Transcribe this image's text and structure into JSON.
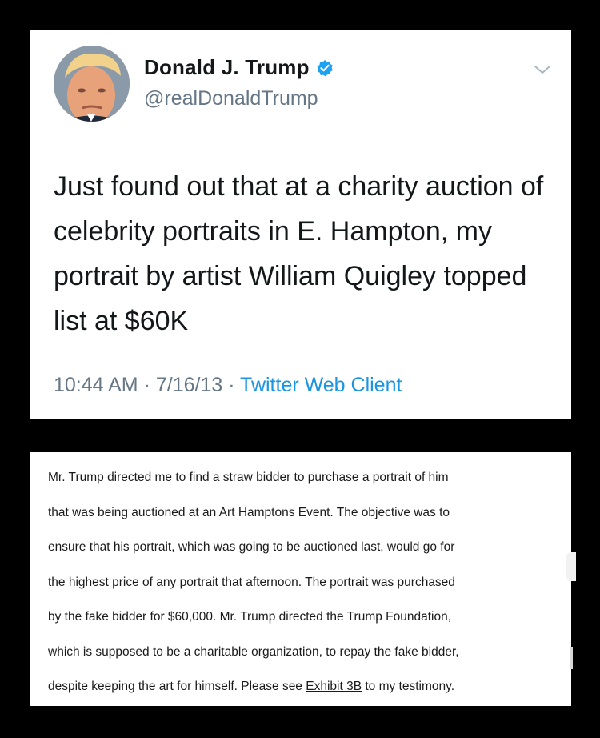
{
  "tweet": {
    "display_name": "Donald J. Trump",
    "handle": "@realDonaldTrump",
    "text": "Just found out that at a charity auction of celebrity portraits in E. Hampton, my portrait by artist William Quigley topped  list at $60K",
    "time": "10:44 AM",
    "separator": " · ",
    "date": "7/16/13",
    "client": "Twitter Web Client",
    "verified_color": "#1da1f2",
    "icons": {
      "verified": "verified-badge-icon",
      "more": "chevron-down-icon"
    }
  },
  "document": {
    "lines": [
      "Mr. Trump directed me to find a straw bidder to purchase a portrait of him",
      "that was being auctioned at an Art Hamptons Event. The objective was to",
      "ensure that his portrait, which was going to be auctioned last, would go for",
      "the highest price of any portrait that afternoon. The portrait was purchased",
      "by the fake bidder for $60,000. Mr. Trump directed the Trump Foundation,",
      "which is supposed to be a charitable organization, to repay the fake bidder,"
    ],
    "last_line_before": "despite keeping the art for himself. Please see ",
    "exhibit_link": "Exhibit 3B",
    "last_line_after": " to my testimony."
  }
}
